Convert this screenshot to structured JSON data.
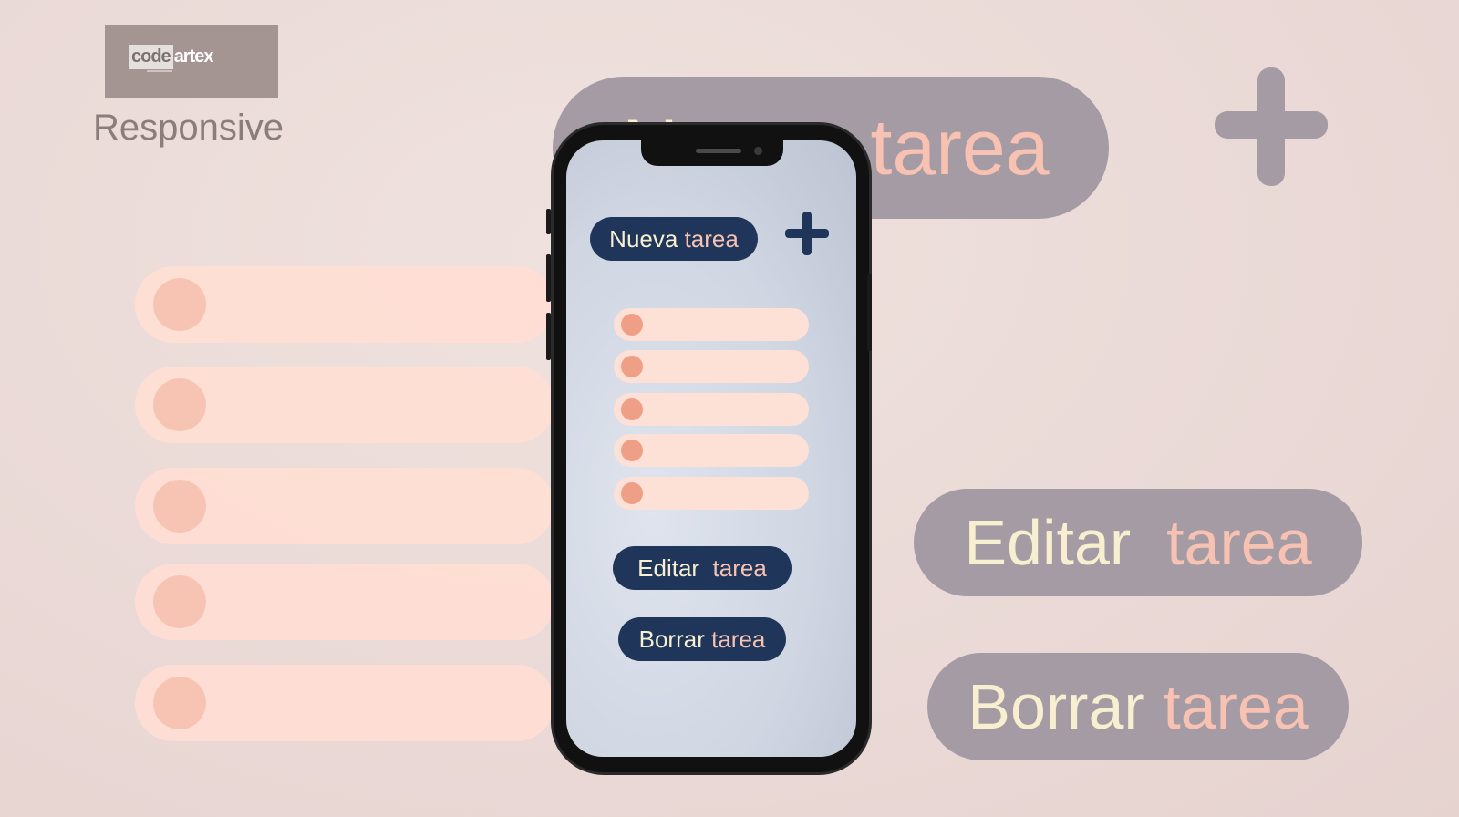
{
  "brand": {
    "logo_code": "code",
    "logo_artex": "artex",
    "tagline": "Responsive"
  },
  "background": {
    "new_task": {
      "word1": "Nueva",
      "word2": "tarea"
    },
    "edit_task": {
      "word1": "Editar",
      "word2": "tarea"
    },
    "delete_task": {
      "word1": "Borrar",
      "word2": "tarea"
    },
    "task_rows": 5
  },
  "phone": {
    "new_task": {
      "word1": "Nueva",
      "word2": "tarea"
    },
    "edit_task": {
      "word1": "Editar",
      "word2": "tarea"
    },
    "delete_task": {
      "word1": "Borrar",
      "word2": "tarea"
    },
    "task_items": 5
  },
  "colors": {
    "navy_button": "#1f3559",
    "cream_text": "#f7efd0",
    "pink_text": "#f7c2b2",
    "task_fill": "#fde0d6",
    "task_dot": "#ef9f86",
    "faded_pill": "#a59ba4"
  },
  "icons": {
    "add": "plus-icon"
  }
}
